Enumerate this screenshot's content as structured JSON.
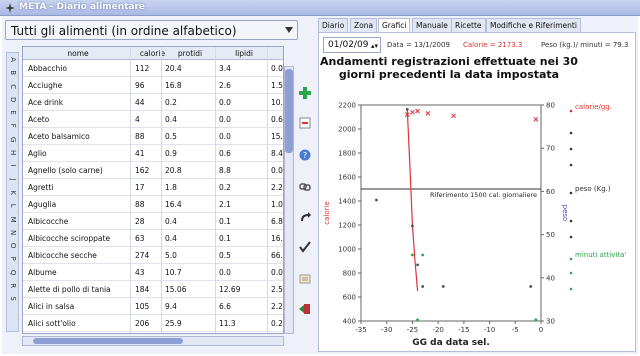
{
  "window": {
    "title": "META - Diario alimentare"
  },
  "food_filter": {
    "value": "Tutti gli alimenti (in ordine alfabetico)"
  },
  "alphabet": [
    "A",
    "B",
    "C",
    "D",
    "E",
    "F",
    "G",
    "H",
    "I",
    "J",
    "K",
    "L",
    "M",
    "N",
    "O",
    "P",
    "Q",
    "R",
    "S"
  ],
  "table": {
    "columns": [
      "nome",
      "calorie",
      "protidi",
      "lipidi"
    ],
    "rows": [
      {
        "nome": "Abbacchio",
        "calorie": "112",
        "protidi": "20.4",
        "lipidi": "3.4",
        "extra": "0.0"
      },
      {
        "nome": "Acciughe",
        "calorie": "96",
        "protidi": "16.8",
        "lipidi": "2.6",
        "extra": "1.5"
      },
      {
        "nome": "Ace drink",
        "calorie": "44",
        "protidi": "0.2",
        "lipidi": "0.0",
        "extra": "10."
      },
      {
        "nome": "Aceto",
        "calorie": "4",
        "protidi": "0.4",
        "lipidi": "0.0",
        "extra": "0.6"
      },
      {
        "nome": "Aceto balsamico",
        "calorie": "88",
        "protidi": "0.5",
        "lipidi": "0.0",
        "extra": "15."
      },
      {
        "nome": "Aglio",
        "calorie": "41",
        "protidi": "0.9",
        "lipidi": "0.6",
        "extra": "8.4"
      },
      {
        "nome": "Agnello (solo carne)",
        "calorie": "162",
        "protidi": "20.8",
        "lipidi": "8.8",
        "extra": "0.0"
      },
      {
        "nome": "Agretti",
        "calorie": "17",
        "protidi": "1.8",
        "lipidi": "0.2",
        "extra": "2.2"
      },
      {
        "nome": "Aguglia",
        "calorie": "88",
        "protidi": "16.4",
        "lipidi": "2.1",
        "extra": "1.0"
      },
      {
        "nome": "Albicocche",
        "calorie": "28",
        "protidi": "0.4",
        "lipidi": "0.1",
        "extra": "6.8"
      },
      {
        "nome": "Albicocche sciroppate",
        "calorie": "63",
        "protidi": "0.4",
        "lipidi": "0.1",
        "extra": "16."
      },
      {
        "nome": "Albicocche secche",
        "calorie": "274",
        "protidi": "5.0",
        "lipidi": "0.5",
        "extra": "66."
      },
      {
        "nome": "Albume",
        "calorie": "43",
        "protidi": "10.7",
        "lipidi": "0.0",
        "extra": "0.0"
      },
      {
        "nome": "Alette di pollo di tania",
        "calorie": "184",
        "protidi": "15.06",
        "lipidi": "12.69",
        "extra": "2.5"
      },
      {
        "nome": "Alici in salsa",
        "calorie": "105",
        "protidi": "9.4",
        "lipidi": "6.6",
        "extra": "2.2"
      },
      {
        "nome": "Alici sott'olio",
        "calorie": "206",
        "protidi": "25.9",
        "lipidi": "11.3",
        "extra": "0.2"
      }
    ]
  },
  "tools": [
    "add-icon",
    "remove-icon",
    "help-icon",
    "link-icon",
    "redo-icon",
    "check-icon",
    "edit-icon",
    "exit-icon"
  ],
  "tabs": [
    "Diario",
    "Zona",
    "Grafici",
    "Manuale",
    "Ricette",
    "Modifiche e Riferimenti"
  ],
  "active_tab": "Grafici",
  "selected_date": "01/02/09",
  "info": {
    "data_label": "Data = 13/1/2009",
    "calorie_label": "Calorie = 2173.3",
    "peso_label": "Peso (kg.)/ minuti = 79.3"
  },
  "chart_data": {
    "type": "scatter",
    "title": "Andamenti registrazioni effettuate nei 30 giorni precedenti la data impostata",
    "xlabel": "GG da data sel.",
    "ylabel_left": "calorie",
    "ylabel_right": "peso",
    "xlim": [
      -35,
      0
    ],
    "ylim_left": [
      400,
      2200
    ],
    "ylim_right": [
      30,
      80
    ],
    "x_ticks": [
      "-35",
      "-30",
      "-25",
      "-20",
      "-15",
      "-10",
      "-5",
      "0"
    ],
    "y_left_ticks": [
      "400",
      "600",
      "800",
      "1000",
      "1200",
      "1400",
      "1600",
      "1800",
      "2000",
      "2200"
    ],
    "y_right_ticks": [
      "30",
      "40",
      "50",
      "60",
      "70",
      "80"
    ],
    "reference_line": {
      "y": 1500,
      "label": "Riferimento 1500 cal. giornaliere"
    },
    "legend": [
      "calorie/gg.",
      "peso (Kg.)",
      "minuti attivita'"
    ],
    "series": [
      {
        "name": "calorie/gg.",
        "color": "#e0303a",
        "marker": "x",
        "points": [
          [
            -26,
            2120
          ],
          [
            -25,
            2140
          ],
          [
            -24,
            2150
          ],
          [
            -22,
            2130
          ],
          [
            -17,
            2110
          ],
          [
            -1,
            2080
          ]
        ]
      },
      {
        "name": "peso (Kg.)",
        "color": "#555555",
        "marker": "o",
        "axis": "right",
        "points": [
          [
            -32,
            58
          ],
          [
            -26,
            79
          ],
          [
            -25,
            52
          ],
          [
            -24,
            43
          ],
          [
            -23,
            38
          ],
          [
            -19,
            38
          ],
          [
            -2,
            38
          ]
        ]
      },
      {
        "name": "minuti attivita'",
        "color": "#22aa44",
        "marker": "o",
        "points": [
          [
            -25,
            950
          ],
          [
            -23,
            950
          ],
          [
            -24,
            410
          ],
          [
            -1,
            410
          ]
        ]
      }
    ],
    "trend": {
      "color": "#e0303a",
      "points": [
        [
          -26,
          2160
        ],
        [
          -25.5,
          1700
        ],
        [
          -25,
          1200
        ],
        [
          -24.5,
          900
        ],
        [
          -24,
          650
        ]
      ]
    }
  }
}
